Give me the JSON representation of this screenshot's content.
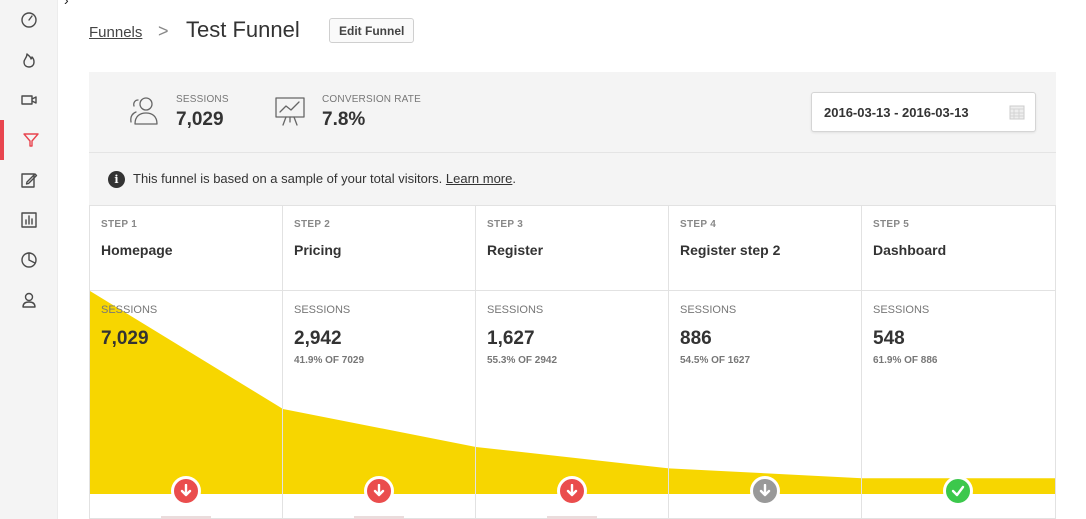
{
  "colors": {
    "accent": "#e8454f",
    "funnel": "#f7d600",
    "drop": "#ea4d4d",
    "neutral": "#999999",
    "success": "#3cc84c"
  },
  "sidebar": {
    "items": [
      {
        "icon": "dashboard-icon",
        "active": false
      },
      {
        "icon": "flame-icon",
        "active": false
      },
      {
        "icon": "video-icon",
        "active": false
      },
      {
        "icon": "funnel-icon",
        "active": true
      },
      {
        "icon": "edit-icon",
        "active": false
      },
      {
        "icon": "bar-chart-icon",
        "active": false
      },
      {
        "icon": "pie-chart-icon",
        "active": false
      },
      {
        "icon": "user-icon",
        "active": false
      }
    ]
  },
  "header": {
    "breadcrumb_link": "Funnels",
    "separator": ">",
    "title": "Test Funnel",
    "edit_label": "Edit Funnel"
  },
  "stats": {
    "sessions_label": "SESSIONS",
    "sessions_value": "7,029",
    "conversion_label": "CONVERSION RATE",
    "conversion_value": "7.8%"
  },
  "date_range": "2016-03-13 - 2016-03-13",
  "info": {
    "text": "This funnel is based on a sample of your total visitors. ",
    "link": "Learn more",
    "suffix": "."
  },
  "steps": [
    {
      "step": "STEP 1",
      "name": "Homepage",
      "sessions_label": "SESSIONS",
      "sessions": "7,029",
      "pct": "",
      "value": 7029,
      "status": "drop"
    },
    {
      "step": "STEP 2",
      "name": "Pricing",
      "sessions_label": "SESSIONS",
      "sessions": "2,942",
      "pct": "41.9% OF 7029",
      "value": 2942,
      "status": "drop"
    },
    {
      "step": "STEP 3",
      "name": "Register",
      "sessions_label": "SESSIONS",
      "sessions": "1,627",
      "pct": "55.3% OF 2942",
      "value": 1627,
      "status": "drop"
    },
    {
      "step": "STEP 4",
      "name": "Register step 2",
      "sessions_label": "SESSIONS",
      "sessions": "886",
      "pct": "54.5% OF 1627",
      "value": 886,
      "status": "neutral"
    },
    {
      "step": "STEP 5",
      "name": "Dashboard",
      "sessions_label": "SESSIONS",
      "sessions": "548",
      "pct": "61.9% OF 886",
      "value": 548,
      "status": "ok"
    }
  ]
}
